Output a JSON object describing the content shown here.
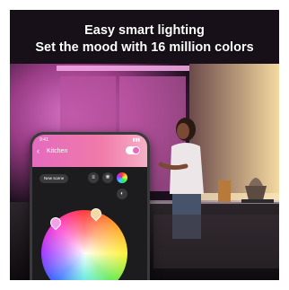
{
  "headline": {
    "line1": "Easy smart lighting",
    "line2": "Set the mood with 16 million colors"
  },
  "phone": {
    "time": "9:41",
    "status": "▮▮▮",
    "room_title": "Kitchen",
    "new_scene_label": "New scene",
    "icons": [
      "back-icon",
      "list-icon",
      "palette-icon",
      "color-wheel-icon",
      "brightness-icon"
    ]
  },
  "colors": {
    "wall_glow": "#c2509a",
    "accent_pink": "#e46bbf",
    "warm_light": "#f3d59a"
  }
}
